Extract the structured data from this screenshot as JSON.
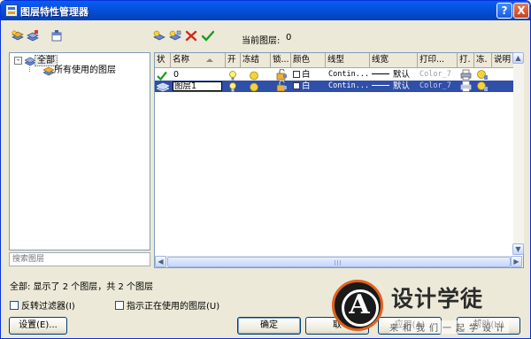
{
  "window": {
    "title": "图层特性管理器",
    "help_label": "?",
    "close_label": "X"
  },
  "toolbar": {
    "current_layer_label": "当前图层:",
    "current_layer_value": "0"
  },
  "tree": {
    "expander": "-",
    "root_label": "全部",
    "child_label": "所有使用的图层"
  },
  "search": {
    "placeholder": "搜索图层"
  },
  "grid": {
    "columns": [
      "状",
      "名称",
      "开",
      "冻结",
      "锁...",
      "颜色",
      "线型",
      "线宽",
      "打印...",
      "打.",
      "冻.",
      "说明"
    ],
    "rows": [
      {
        "status_icon": "green-check-icon",
        "name": "0",
        "color": "白",
        "linetype": "Contin...",
        "lineweight": "默认",
        "plot_style": "Color_7",
        "selected": false
      },
      {
        "status_icon": "layer-stack-icon",
        "name": "图层1",
        "color": "白",
        "linetype": "Contin...",
        "lineweight": "默认",
        "plot_style": "Color_7",
        "selected": true
      }
    ]
  },
  "status": {
    "text": "全部: 显示了 2 个图层，共 2 个图层"
  },
  "options": {
    "invert_filter": "反转过滤器(I)",
    "indicate_used": "指示正在使用的图层(U)"
  },
  "buttons": {
    "settings": "设置(E)...",
    "ok": "确定",
    "cancel": "取",
    "apply": "应用(A)",
    "help": "帮助(H)"
  },
  "watermark": {
    "logo_letter": "A",
    "title": "设计学徒",
    "subtitle": "来和我们一起学设计"
  },
  "colors": {
    "selection": "#2f4fa8",
    "titlebar": "#0450d8",
    "dialog_bg": "#ece9d8",
    "watermark_ring": "#e0611a"
  }
}
